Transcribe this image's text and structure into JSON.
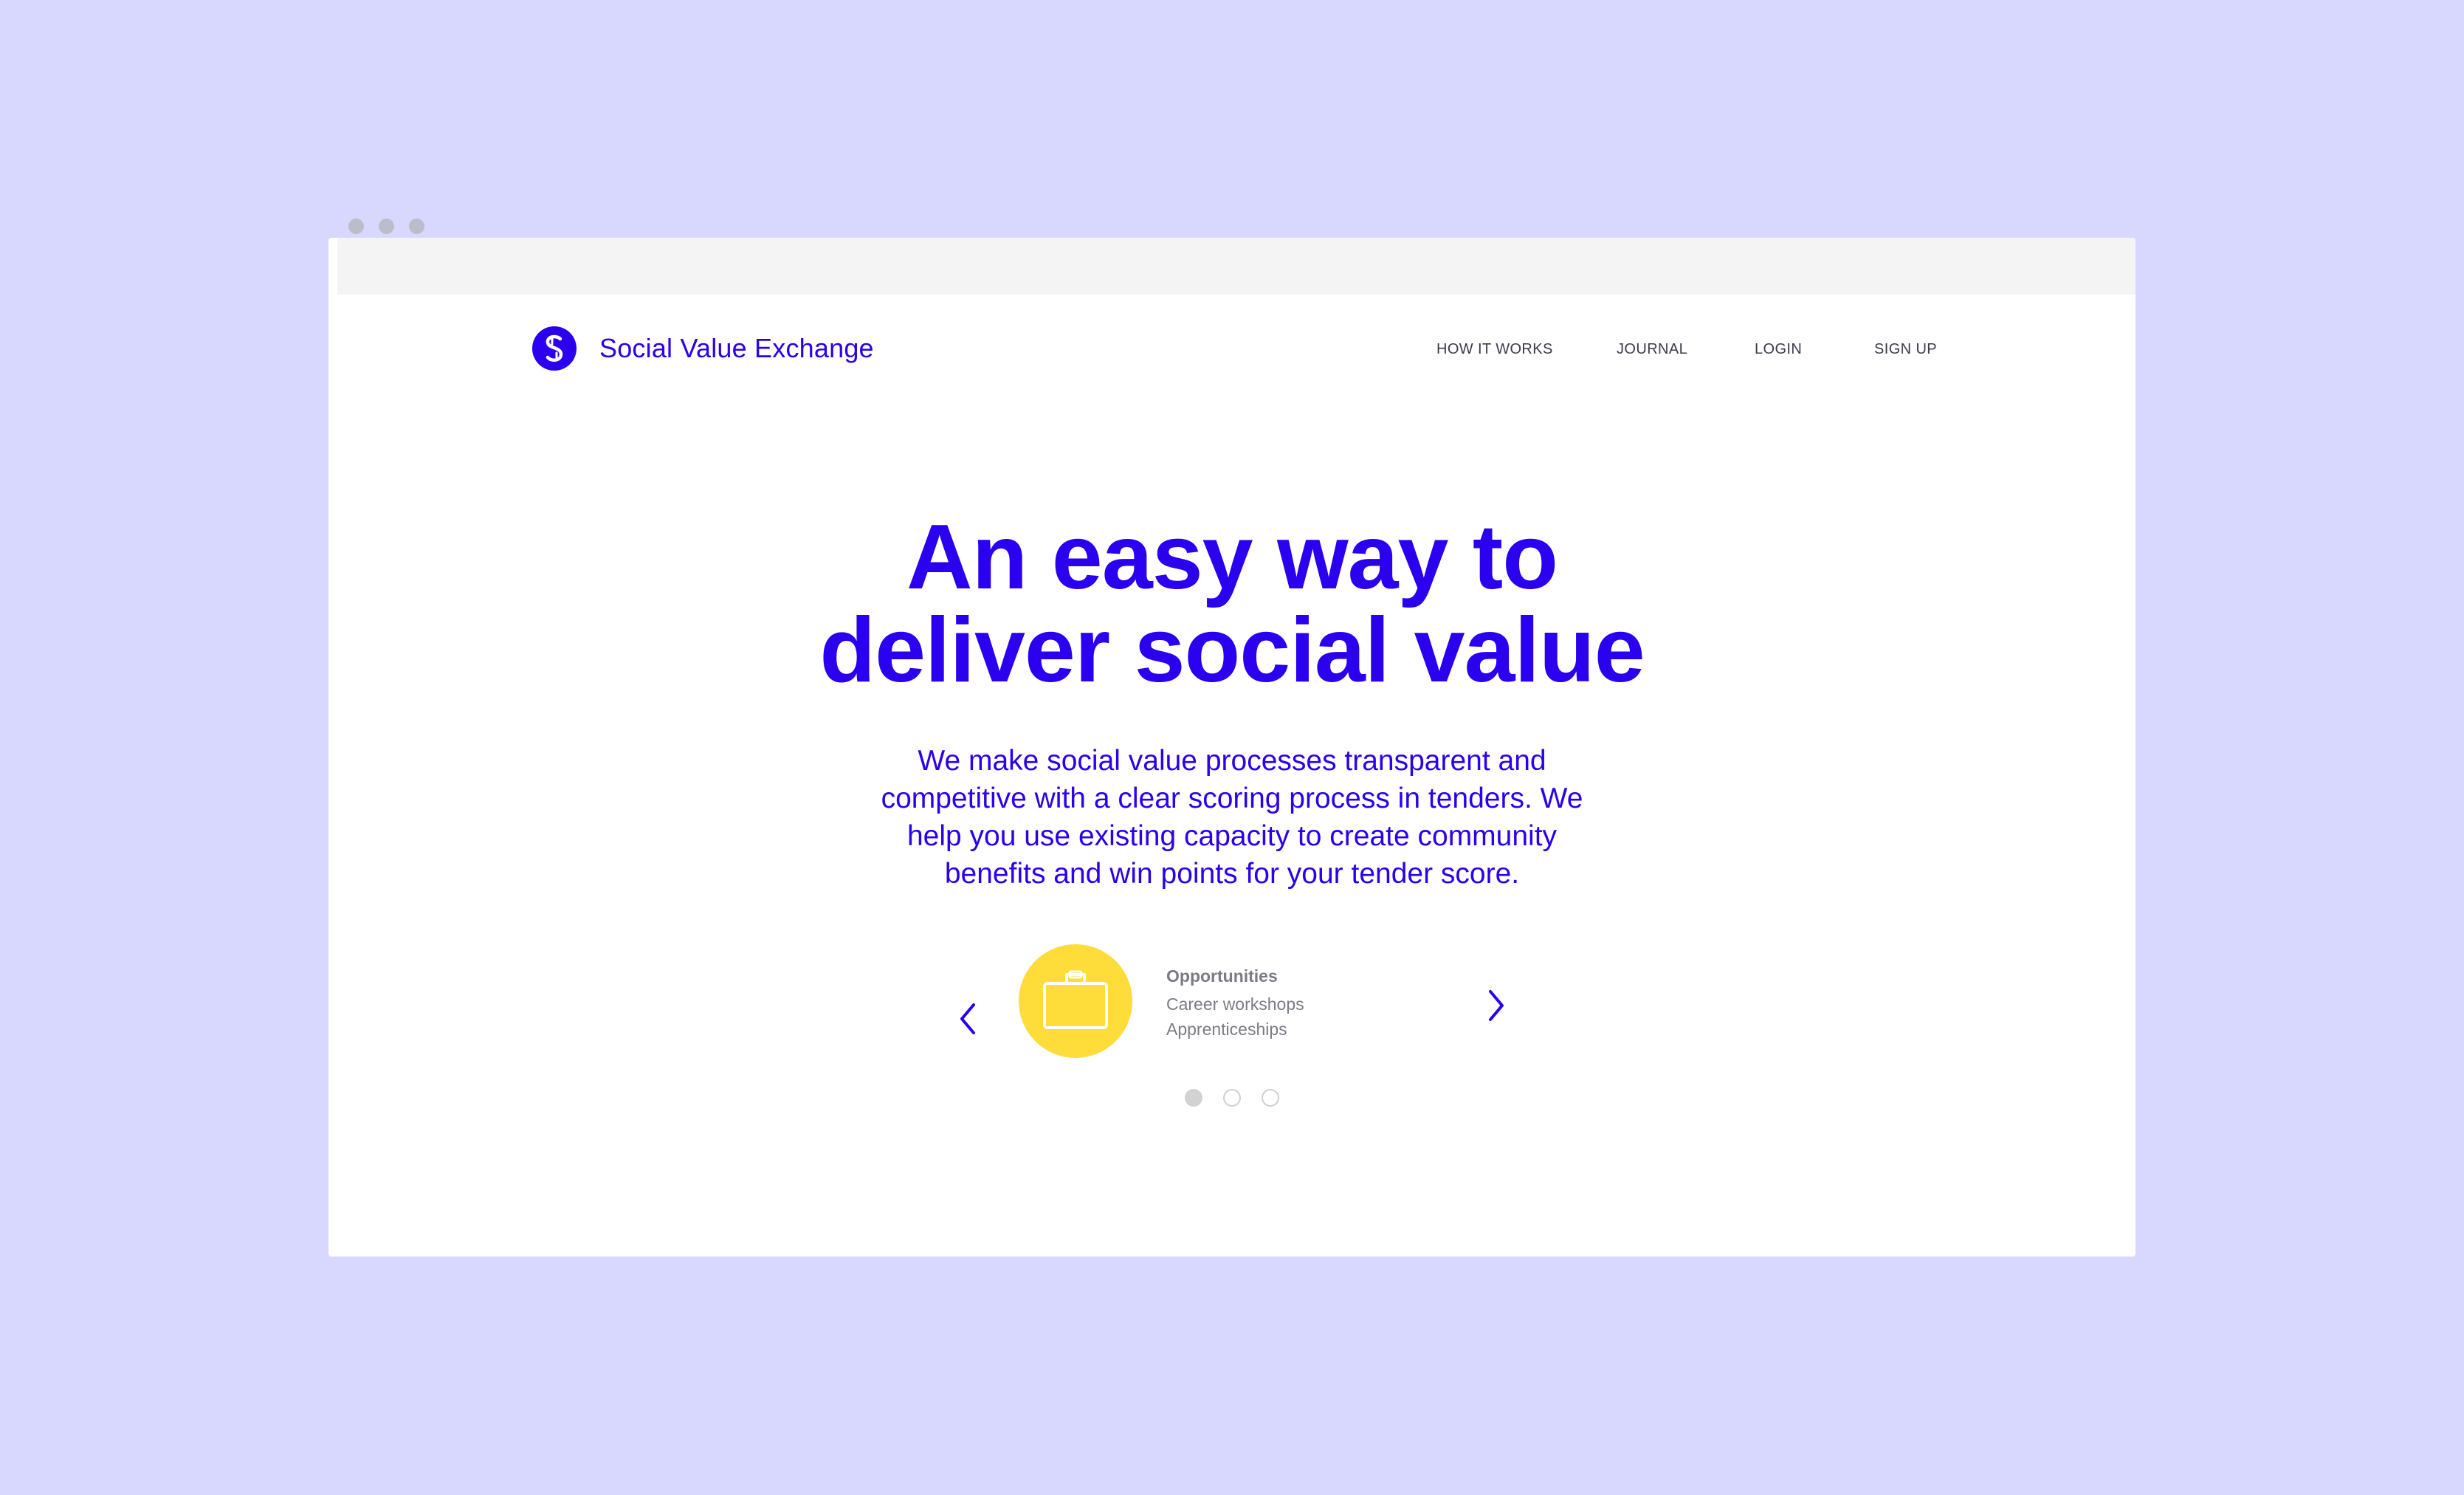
{
  "browser": {
    "window_controls": [
      "close",
      "minimize",
      "maximize"
    ]
  },
  "site": {
    "name": "Social Value Exchange",
    "logo_icon": "s-logo-icon",
    "brand_color": "#2a00ee"
  },
  "nav": {
    "items": [
      {
        "label": "HOW IT WORKS"
      },
      {
        "label": "JOURNAL"
      },
      {
        "label": "LOGIN"
      },
      {
        "label": "SIGN UP"
      }
    ]
  },
  "hero": {
    "headline_line1": "An easy way to",
    "headline_line2": "deliver social value",
    "description": "We make social value processes transparent and competitive with a clear scoring process in tenders. We help you use existing capacity to create community benefits and win points for your tender score."
  },
  "carousel": {
    "prev_icon": "chevron-left-icon",
    "next_icon": "chevron-right-icon",
    "slide_icon": "briefcase-icon",
    "slide_icon_bg": "#fedc3a",
    "items": [
      "Opportunities",
      "Career workshops",
      "Apprenticeships"
    ],
    "page_count": 3,
    "active_page": 1
  }
}
